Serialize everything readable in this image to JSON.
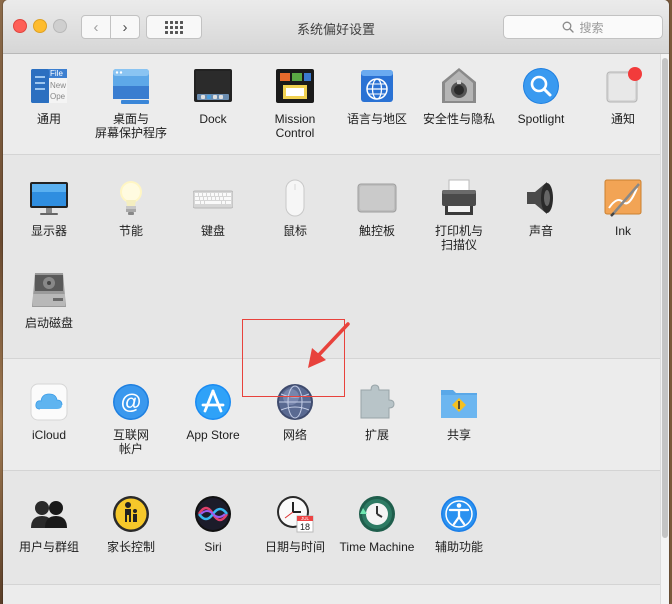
{
  "window": {
    "title": "系统偏好设置"
  },
  "search": {
    "placeholder": "搜索"
  },
  "rows": [
    [
      {
        "label": "通用",
        "icon": "general-icon"
      },
      {
        "label": "桌面与\n屏幕保护程序",
        "icon": "desktop-screensaver-icon"
      },
      {
        "label": "Dock",
        "icon": "dock-icon"
      },
      {
        "label": "Mission\nControl",
        "icon": "mission-control-icon"
      },
      {
        "label": "语言与地区",
        "icon": "language-region-icon"
      },
      {
        "label": "安全性与隐私",
        "icon": "security-privacy-icon"
      },
      {
        "label": "Spotlight",
        "icon": "spotlight-icon"
      },
      {
        "label": "通知",
        "icon": "notifications-icon"
      }
    ],
    [
      {
        "label": "显示器",
        "icon": "displays-icon"
      },
      {
        "label": "节能",
        "icon": "energy-saver-icon"
      },
      {
        "label": "键盘",
        "icon": "keyboard-icon"
      },
      {
        "label": "鼠标",
        "icon": "mouse-icon"
      },
      {
        "label": "触控板",
        "icon": "trackpad-icon"
      },
      {
        "label": "打印机与\n扫描仪",
        "icon": "printers-scanners-icon"
      },
      {
        "label": "声音",
        "icon": "sound-icon"
      },
      {
        "label": "Ink",
        "icon": "ink-icon"
      }
    ],
    [
      {
        "label": "启动磁盘",
        "icon": "startup-disk-icon"
      }
    ],
    [
      {
        "label": "iCloud",
        "icon": "icloud-icon"
      },
      {
        "label": "互联网\n帐户",
        "icon": "internet-accounts-icon"
      },
      {
        "label": "App Store",
        "icon": "app-store-icon"
      },
      {
        "label": "网络",
        "icon": "network-icon"
      },
      {
        "label": "扩展",
        "icon": "extensions-icon"
      },
      {
        "label": "共享",
        "icon": "sharing-icon"
      }
    ],
    [
      {
        "label": "用户与群组",
        "icon": "users-groups-icon"
      },
      {
        "label": "家长控制",
        "icon": "parental-controls-icon"
      },
      {
        "label": "Siri",
        "icon": "siri-icon"
      },
      {
        "label": "日期与时间",
        "icon": "date-time-icon"
      },
      {
        "label": "Time Machine",
        "icon": "time-machine-icon"
      },
      {
        "label": "辅助功能",
        "icon": "accessibility-icon"
      }
    ]
  ],
  "icon_text": {
    "general_file": "File",
    "general_new": "New",
    "general_ope": "Ope",
    "calendar_month": "JUL",
    "calendar_day": "18"
  },
  "colors": {
    "highlight": "#e8423c",
    "accent_blue": "#1e88e5"
  }
}
